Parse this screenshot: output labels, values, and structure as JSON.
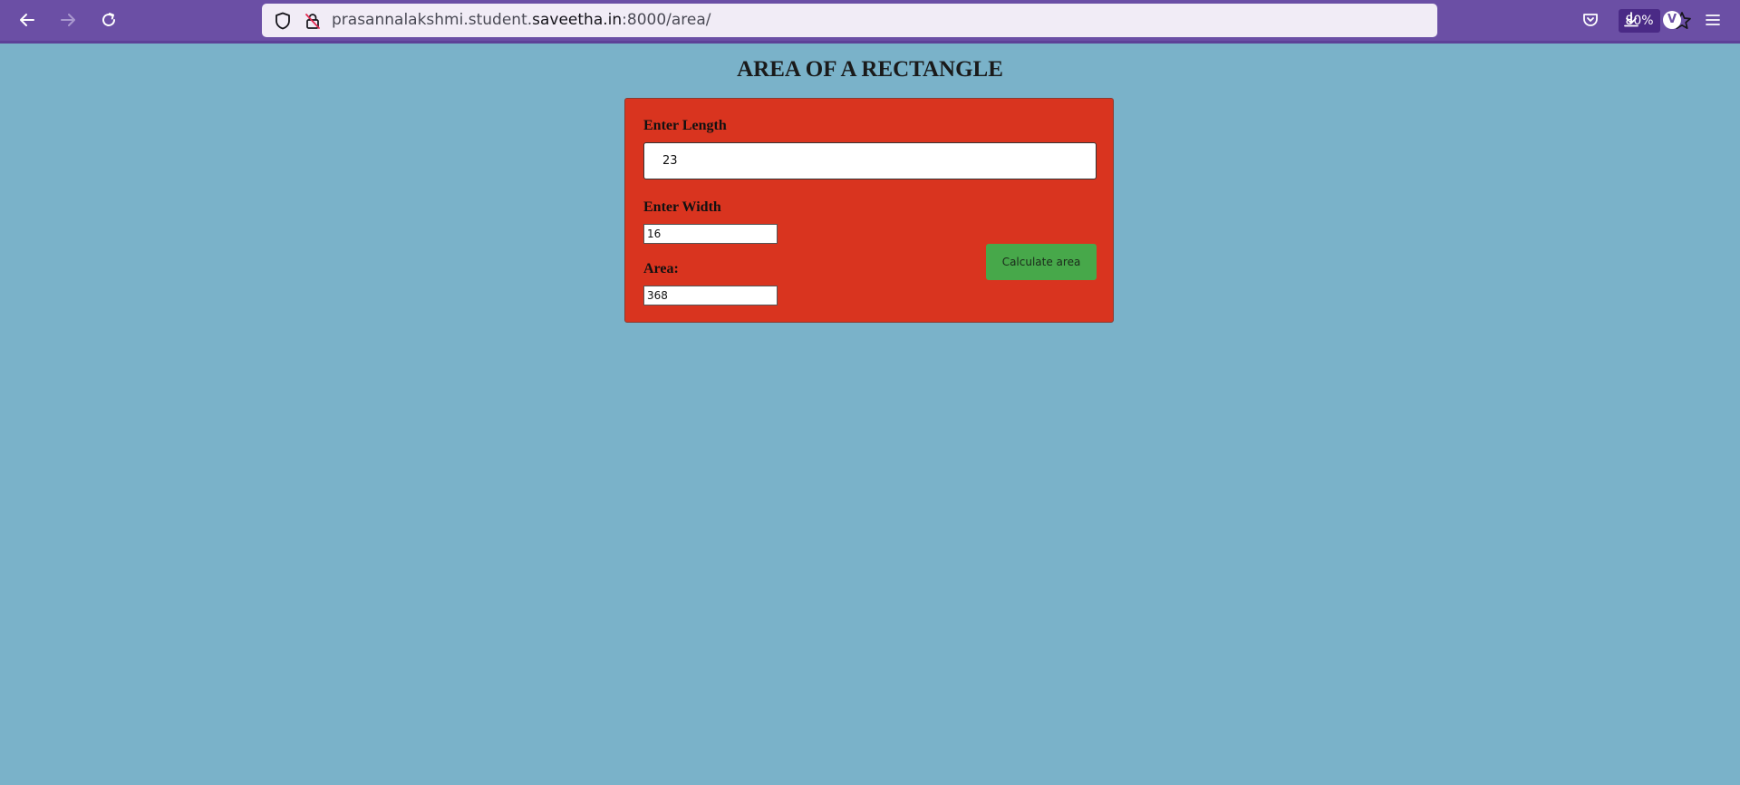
{
  "browser": {
    "url_prefix": "prasannalakshmi.student.",
    "url_domain": "saveetha.in",
    "url_suffix": ":8000/area/",
    "zoom": "80%",
    "account_initial": "V",
    "toolbar_icons": [
      "back-arrow-icon",
      "forward-arrow-icon",
      "reload-icon",
      "shield-icon",
      "insecure-lock-icon",
      "star-icon",
      "pocket-icon",
      "download-icon",
      "account-icon",
      "hamburger-menu-icon"
    ],
    "colors": {
      "toolbar": "#6b4fa5",
      "urlbar": "#f1ecf6",
      "zoom_badge": "#4a2a86"
    }
  },
  "page": {
    "title": "AREA OF A RECTANGLE",
    "background": "#7ab2c9"
  },
  "form": {
    "length_label": "Enter Length",
    "length_value": "23",
    "width_label": "Enter Width",
    "width_value": "16",
    "area_label": "Area:",
    "area_value": "368",
    "button_label": "Calculate area",
    "colors": {
      "card": "#d9341f",
      "button": "#47a84a"
    }
  }
}
